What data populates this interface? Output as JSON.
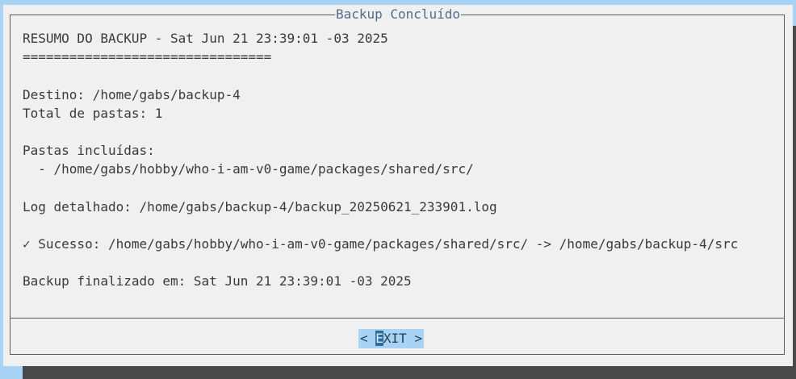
{
  "dialog": {
    "title": "Backup Concluído",
    "lines": [
      "RESUMO DO BACKUP - Sat Jun 21 23:39:01 -03 2025",
      "================================",
      "",
      "Destino: /home/gabs/backup-4",
      "Total de pastas: 1",
      "",
      "Pastas incluídas:",
      "  - /home/gabs/hobby/who-i-am-v0-game/packages/shared/src/",
      "",
      "Log detalhado: /home/gabs/backup-4/backup_20250621_233901.log",
      "",
      "✓ Sucesso: /home/gabs/hobby/who-i-am-v0-game/packages/shared/src/ -> /home/gabs/backup-4/src",
      "",
      "Backup finalizado em: Sat Jun 21 23:39:01 -03 2025"
    ],
    "exit_button": {
      "prefix": "< ",
      "hotkey": "E",
      "rest": "XIT >"
    }
  },
  "colors": {
    "background": "#a9d3f5",
    "dialog": "#f0f0f0",
    "shadow": "#4a4a4a",
    "title": "#4f6d8a",
    "button_bg": "#a9d3f5",
    "hotkey_bg": "#2f6b9a"
  }
}
